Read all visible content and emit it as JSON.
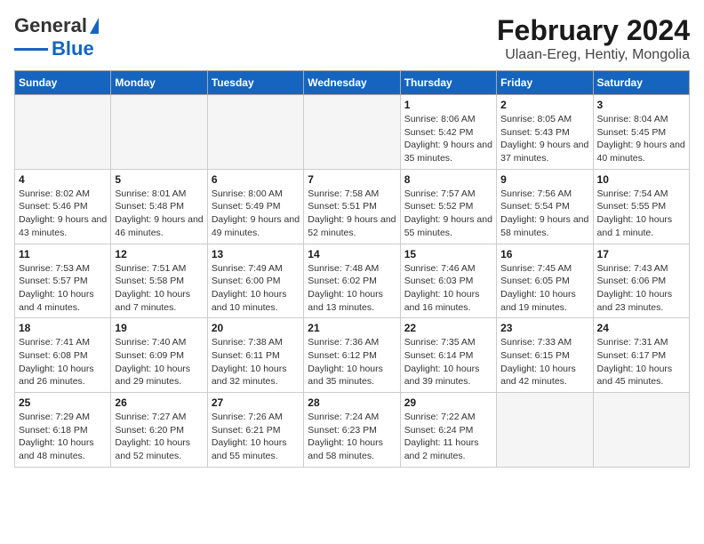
{
  "logo": {
    "line1": "General",
    "line2": "Blue"
  },
  "title": "February 2024",
  "subtitle": "Ulaan-Ereg, Hentiy, Mongolia",
  "days_of_week": [
    "Sunday",
    "Monday",
    "Tuesday",
    "Wednesday",
    "Thursday",
    "Friday",
    "Saturday"
  ],
  "weeks": [
    [
      {
        "date": "",
        "sunrise": "",
        "sunset": "",
        "daylight": "",
        "empty": true
      },
      {
        "date": "",
        "sunrise": "",
        "sunset": "",
        "daylight": "",
        "empty": true
      },
      {
        "date": "",
        "sunrise": "",
        "sunset": "",
        "daylight": "",
        "empty": true
      },
      {
        "date": "",
        "sunrise": "",
        "sunset": "",
        "daylight": "",
        "empty": true
      },
      {
        "date": "1",
        "sunrise": "Sunrise: 8:06 AM",
        "sunset": "Sunset: 5:42 PM",
        "daylight": "Daylight: 9 hours and 35 minutes.",
        "empty": false
      },
      {
        "date": "2",
        "sunrise": "Sunrise: 8:05 AM",
        "sunset": "Sunset: 5:43 PM",
        "daylight": "Daylight: 9 hours and 37 minutes.",
        "empty": false
      },
      {
        "date": "3",
        "sunrise": "Sunrise: 8:04 AM",
        "sunset": "Sunset: 5:45 PM",
        "daylight": "Daylight: 9 hours and 40 minutes.",
        "empty": false
      }
    ],
    [
      {
        "date": "4",
        "sunrise": "Sunrise: 8:02 AM",
        "sunset": "Sunset: 5:46 PM",
        "daylight": "Daylight: 9 hours and 43 minutes.",
        "empty": false
      },
      {
        "date": "5",
        "sunrise": "Sunrise: 8:01 AM",
        "sunset": "Sunset: 5:48 PM",
        "daylight": "Daylight: 9 hours and 46 minutes.",
        "empty": false
      },
      {
        "date": "6",
        "sunrise": "Sunrise: 8:00 AM",
        "sunset": "Sunset: 5:49 PM",
        "daylight": "Daylight: 9 hours and 49 minutes.",
        "empty": false
      },
      {
        "date": "7",
        "sunrise": "Sunrise: 7:58 AM",
        "sunset": "Sunset: 5:51 PM",
        "daylight": "Daylight: 9 hours and 52 minutes.",
        "empty": false
      },
      {
        "date": "8",
        "sunrise": "Sunrise: 7:57 AM",
        "sunset": "Sunset: 5:52 PM",
        "daylight": "Daylight: 9 hours and 55 minutes.",
        "empty": false
      },
      {
        "date": "9",
        "sunrise": "Sunrise: 7:56 AM",
        "sunset": "Sunset: 5:54 PM",
        "daylight": "Daylight: 9 hours and 58 minutes.",
        "empty": false
      },
      {
        "date": "10",
        "sunrise": "Sunrise: 7:54 AM",
        "sunset": "Sunset: 5:55 PM",
        "daylight": "Daylight: 10 hours and 1 minute.",
        "empty": false
      }
    ],
    [
      {
        "date": "11",
        "sunrise": "Sunrise: 7:53 AM",
        "sunset": "Sunset: 5:57 PM",
        "daylight": "Daylight: 10 hours and 4 minutes.",
        "empty": false
      },
      {
        "date": "12",
        "sunrise": "Sunrise: 7:51 AM",
        "sunset": "Sunset: 5:58 PM",
        "daylight": "Daylight: 10 hours and 7 minutes.",
        "empty": false
      },
      {
        "date": "13",
        "sunrise": "Sunrise: 7:49 AM",
        "sunset": "Sunset: 6:00 PM",
        "daylight": "Daylight: 10 hours and 10 minutes.",
        "empty": false
      },
      {
        "date": "14",
        "sunrise": "Sunrise: 7:48 AM",
        "sunset": "Sunset: 6:02 PM",
        "daylight": "Daylight: 10 hours and 13 minutes.",
        "empty": false
      },
      {
        "date": "15",
        "sunrise": "Sunrise: 7:46 AM",
        "sunset": "Sunset: 6:03 PM",
        "daylight": "Daylight: 10 hours and 16 minutes.",
        "empty": false
      },
      {
        "date": "16",
        "sunrise": "Sunrise: 7:45 AM",
        "sunset": "Sunset: 6:05 PM",
        "daylight": "Daylight: 10 hours and 19 minutes.",
        "empty": false
      },
      {
        "date": "17",
        "sunrise": "Sunrise: 7:43 AM",
        "sunset": "Sunset: 6:06 PM",
        "daylight": "Daylight: 10 hours and 23 minutes.",
        "empty": false
      }
    ],
    [
      {
        "date": "18",
        "sunrise": "Sunrise: 7:41 AM",
        "sunset": "Sunset: 6:08 PM",
        "daylight": "Daylight: 10 hours and 26 minutes.",
        "empty": false
      },
      {
        "date": "19",
        "sunrise": "Sunrise: 7:40 AM",
        "sunset": "Sunset: 6:09 PM",
        "daylight": "Daylight: 10 hours and 29 minutes.",
        "empty": false
      },
      {
        "date": "20",
        "sunrise": "Sunrise: 7:38 AM",
        "sunset": "Sunset: 6:11 PM",
        "daylight": "Daylight: 10 hours and 32 minutes.",
        "empty": false
      },
      {
        "date": "21",
        "sunrise": "Sunrise: 7:36 AM",
        "sunset": "Sunset: 6:12 PM",
        "daylight": "Daylight: 10 hours and 35 minutes.",
        "empty": false
      },
      {
        "date": "22",
        "sunrise": "Sunrise: 7:35 AM",
        "sunset": "Sunset: 6:14 PM",
        "daylight": "Daylight: 10 hours and 39 minutes.",
        "empty": false
      },
      {
        "date": "23",
        "sunrise": "Sunrise: 7:33 AM",
        "sunset": "Sunset: 6:15 PM",
        "daylight": "Daylight: 10 hours and 42 minutes.",
        "empty": false
      },
      {
        "date": "24",
        "sunrise": "Sunrise: 7:31 AM",
        "sunset": "Sunset: 6:17 PM",
        "daylight": "Daylight: 10 hours and 45 minutes.",
        "empty": false
      }
    ],
    [
      {
        "date": "25",
        "sunrise": "Sunrise: 7:29 AM",
        "sunset": "Sunset: 6:18 PM",
        "daylight": "Daylight: 10 hours and 48 minutes.",
        "empty": false
      },
      {
        "date": "26",
        "sunrise": "Sunrise: 7:27 AM",
        "sunset": "Sunset: 6:20 PM",
        "daylight": "Daylight: 10 hours and 52 minutes.",
        "empty": false
      },
      {
        "date": "27",
        "sunrise": "Sunrise: 7:26 AM",
        "sunset": "Sunset: 6:21 PM",
        "daylight": "Daylight: 10 hours and 55 minutes.",
        "empty": false
      },
      {
        "date": "28",
        "sunrise": "Sunrise: 7:24 AM",
        "sunset": "Sunset: 6:23 PM",
        "daylight": "Daylight: 10 hours and 58 minutes.",
        "empty": false
      },
      {
        "date": "29",
        "sunrise": "Sunrise: 7:22 AM",
        "sunset": "Sunset: 6:24 PM",
        "daylight": "Daylight: 11 hours and 2 minutes.",
        "empty": false
      },
      {
        "date": "",
        "sunrise": "",
        "sunset": "",
        "daylight": "",
        "empty": true
      },
      {
        "date": "",
        "sunrise": "",
        "sunset": "",
        "daylight": "",
        "empty": true
      }
    ]
  ]
}
